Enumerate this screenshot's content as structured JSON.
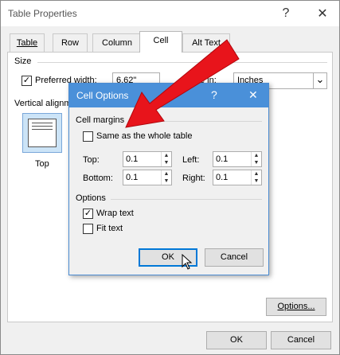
{
  "outer_dialog": {
    "title": "Table Properties",
    "help_label": "?",
    "close_label": "✕",
    "tabs": [
      "Table",
      "Row",
      "Column",
      "Cell",
      "Alt Text"
    ],
    "size_section": "Size",
    "preferred_width_label": "Preferred width:",
    "preferred_width_value": "6.62\"",
    "measure_in_label": "e in:",
    "measure_in_value": "Inches",
    "vertical_alignment_label": "Vertical alignm",
    "top_align_label": "Top",
    "options_button": "Options...",
    "ok_button": "OK",
    "cancel_button": "Cancel"
  },
  "cell_options": {
    "title": "Cell Options",
    "help_label": "?",
    "close_label": "✕",
    "cell_margins_label": "Cell margins",
    "same_as_table_label": "Same as the whole table",
    "same_as_table_checked": false,
    "top_label": "Top:",
    "top_value": "0.1",
    "left_label": "Left:",
    "left_value": "0.1",
    "bottom_label": "Bottom:",
    "bottom_value": "0.1",
    "right_label": "Right:",
    "right_value": "0.1",
    "options_label": "Options",
    "wrap_text_label": "Wrap text",
    "wrap_text_checked": true,
    "fit_text_label": "Fit text",
    "fit_text_checked": false,
    "ok_button": "OK",
    "cancel_button": "Cancel"
  },
  "annotation": {
    "arrow_color": "#e8141b"
  },
  "icons": {
    "check": "✓",
    "spin_up": "▲",
    "spin_down": "▼",
    "dropdown": "⌄"
  }
}
